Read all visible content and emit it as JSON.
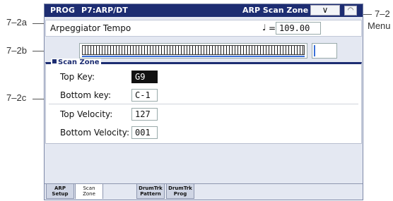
{
  "callouts": {
    "a": "7–2a",
    "b": "7–2b",
    "c": "7–2c",
    "right_top": "7–2",
    "right_bottom": "Menu"
  },
  "titlebar": {
    "mode": "PROG",
    "page": "P7:ARP/DT",
    "section": "ARP Scan Zone",
    "menu_icon": "chevron-down-icon",
    "lock_icon": "lock-icon"
  },
  "tempo": {
    "label": "Arpeggiator Tempo",
    "note_symbol": "♩",
    "equals": "=",
    "value": "109.00"
  },
  "scan_zone": {
    "title": "Scan Zone",
    "fields": [
      {
        "label": "Top Key:",
        "value": "G9",
        "selected": true
      },
      {
        "label": "Bottom key:",
        "value": "C-1",
        "selected": false
      },
      {
        "label": "Top Velocity:",
        "value": "127",
        "selected": false
      },
      {
        "label": "Bottom Velocity:",
        "value": "001",
        "selected": false
      }
    ]
  },
  "tabs": [
    {
      "label": "ARP Setup",
      "line1": "ARP",
      "line2": "Setup",
      "active": false
    },
    {
      "label": "Scan Zone",
      "line1": "Scan",
      "line2": "Zone",
      "active": true
    },
    {
      "label": "DrumTrk Pattern",
      "line1": "DrumTrk",
      "line2": "Pattern",
      "active": false
    },
    {
      "label": "DrumTrk Prog",
      "line1": "DrumTrk",
      "line2": "Prog",
      "active": false
    }
  ],
  "colors": {
    "titlebar": "#1d2d72",
    "accent_blue": "#3a6fd8",
    "panel_bg": "#e4e8f2"
  }
}
